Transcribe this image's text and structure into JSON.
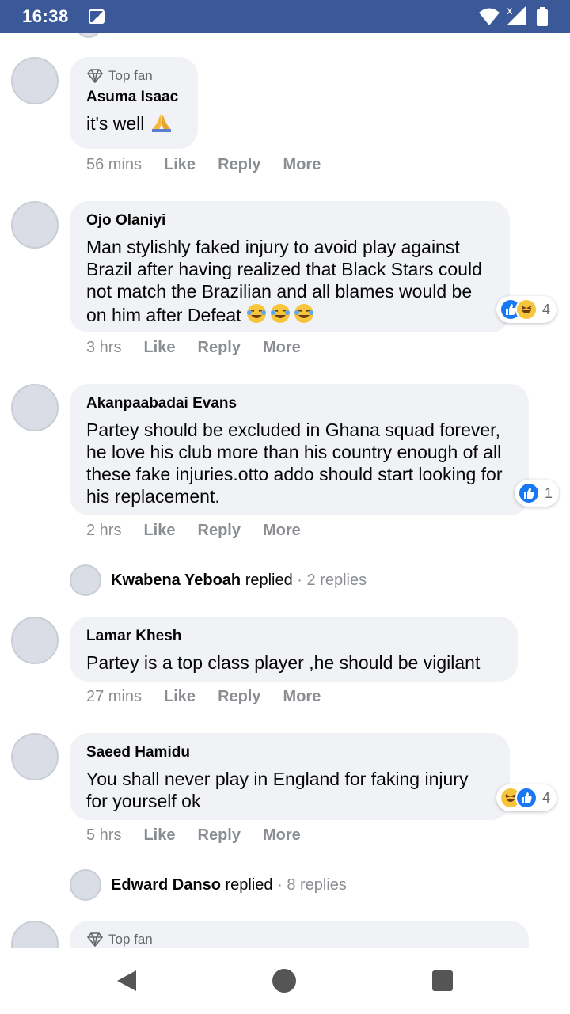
{
  "status": {
    "time": "16:38"
  },
  "comments": [
    {
      "badge": "Top fan",
      "author": "Asuma Isaac",
      "text": "it's well",
      "emoji_suffix": "praying-hands",
      "time": "56 mins",
      "like": "Like",
      "reply": "Reply",
      "more": "More"
    },
    {
      "author": "Ojo Olaniyi",
      "text": "Man stylishly faked injury to avoid play against Brazil after having realized that Black Stars could not match the Brazilian and all blames would be on him after Defeat",
      "emoji_suffix": "laughing x3",
      "time": "3 hrs",
      "like": "Like",
      "reply": "Reply",
      "more": "More",
      "reaction_count": "4"
    },
    {
      "author": "Akanpaabadai Evans",
      "text": "Partey should be excluded in Ghana squad forever, he love his club more than his country enough of all these fake injuries.otto addo should start looking for his replacement.",
      "time": "2 hrs",
      "like": "Like",
      "reply": "Reply",
      "more": "More",
      "reaction_count": "1"
    },
    {
      "author": "Lamar Khesh",
      "text": "Partey is a top class player ,he should be vigilant",
      "time": "27 mins",
      "like": "Like",
      "reply": "Reply",
      "more": "More"
    },
    {
      "author": "Saeed Hamidu",
      "text": "You shall never play in England for faking injury for yourself ok",
      "time": "5 hrs",
      "like": "Like",
      "reply": "Reply",
      "more": "More",
      "reaction_count": "4"
    },
    {
      "badge": "Top fan"
    }
  ],
  "replies": [
    {
      "name": "Kwabena Yeboah",
      "verb": "replied",
      "sep": " · ",
      "count": "2 replies"
    },
    {
      "name": "Edward Danso",
      "verb": "replied",
      "sep": " · ",
      "count": "8 replies"
    }
  ],
  "colors": {
    "status_bar": "#3b5998",
    "bubble": "#f0f2f5",
    "like_blue": "#1877f2",
    "muted": "#8a8d91"
  },
  "icons": [
    "image-icon",
    "wifi-icon",
    "signal-icon",
    "battery-icon",
    "diamond-icon",
    "like-reaction-icon",
    "haha-reaction-icon",
    "back-icon",
    "home-icon",
    "recents-icon"
  ]
}
